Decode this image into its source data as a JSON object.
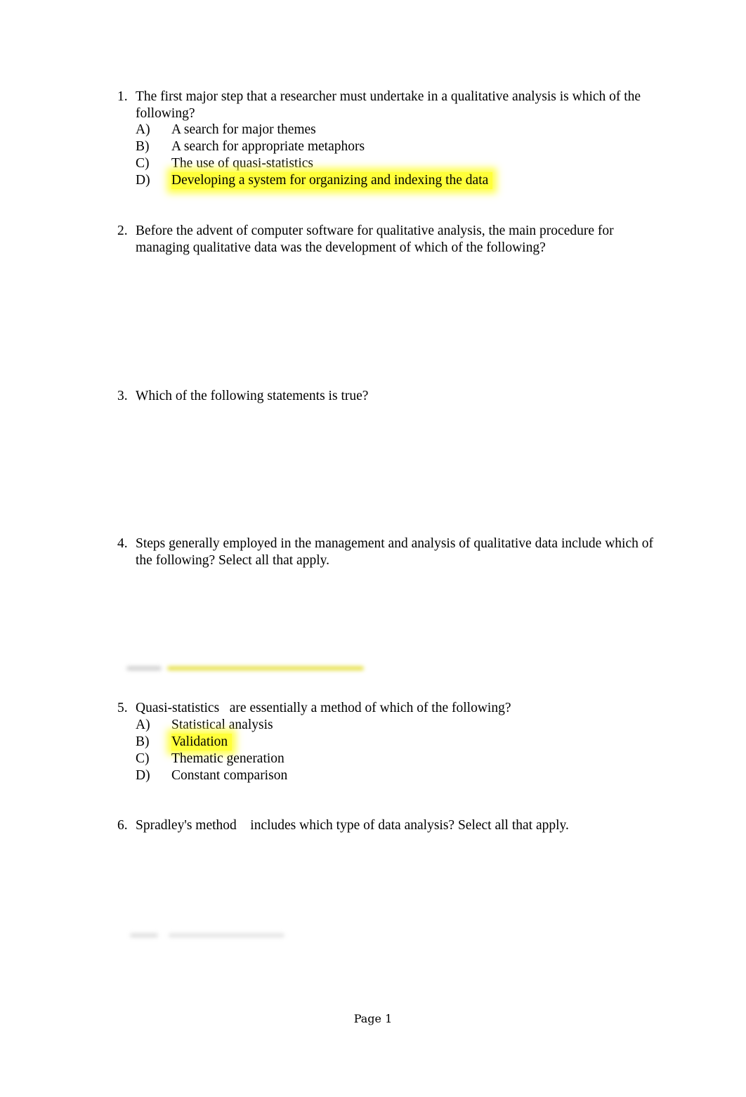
{
  "questions": [
    {
      "number": "1.",
      "text": "The first major step that a researcher must undertake in a qualitative analysis is which of the following?",
      "options": [
        {
          "letter": "A)",
          "text": "A search for major themes",
          "highlighted": false
        },
        {
          "letter": "B)",
          "text": "A search for appropriate metaphors",
          "highlighted": false
        },
        {
          "letter": "C)",
          "text": "The use of quasi-statistics",
          "highlighted": false
        },
        {
          "letter": "D)",
          "text": "Developing a system for organizing and indexing the data",
          "highlighted": true
        }
      ]
    },
    {
      "number": "2.",
      "text": "Before the advent of computer software for qualitative analysis, the main procedure for managing qualitative data was the development of which of the following?"
    },
    {
      "number": "3.",
      "text": "Which of the following statements is true?"
    },
    {
      "number": "4.",
      "text": "Steps generally employed in the management and analysis of qualitative data include which of the following? Select all that apply."
    },
    {
      "number": "5.",
      "text": "Quasi-statistics   are essentially a method of which of the following?",
      "options": [
        {
          "letter": "A)",
          "text": "Statistical analysis",
          "highlighted": false
        },
        {
          "letter": "B)",
          "text": "Validation",
          "highlighted": true
        },
        {
          "letter": "C)",
          "text": "Thematic generation",
          "highlighted": false
        },
        {
          "letter": "D)",
          "text": "Constant comparison",
          "highlighted": false
        }
      ]
    },
    {
      "number": "6.",
      "text": "Spradley's method    includes which type of data analysis? Select all that apply."
    }
  ],
  "highlight_color": "#ffff3a",
  "footer": {
    "page_label": "Page 1"
  }
}
